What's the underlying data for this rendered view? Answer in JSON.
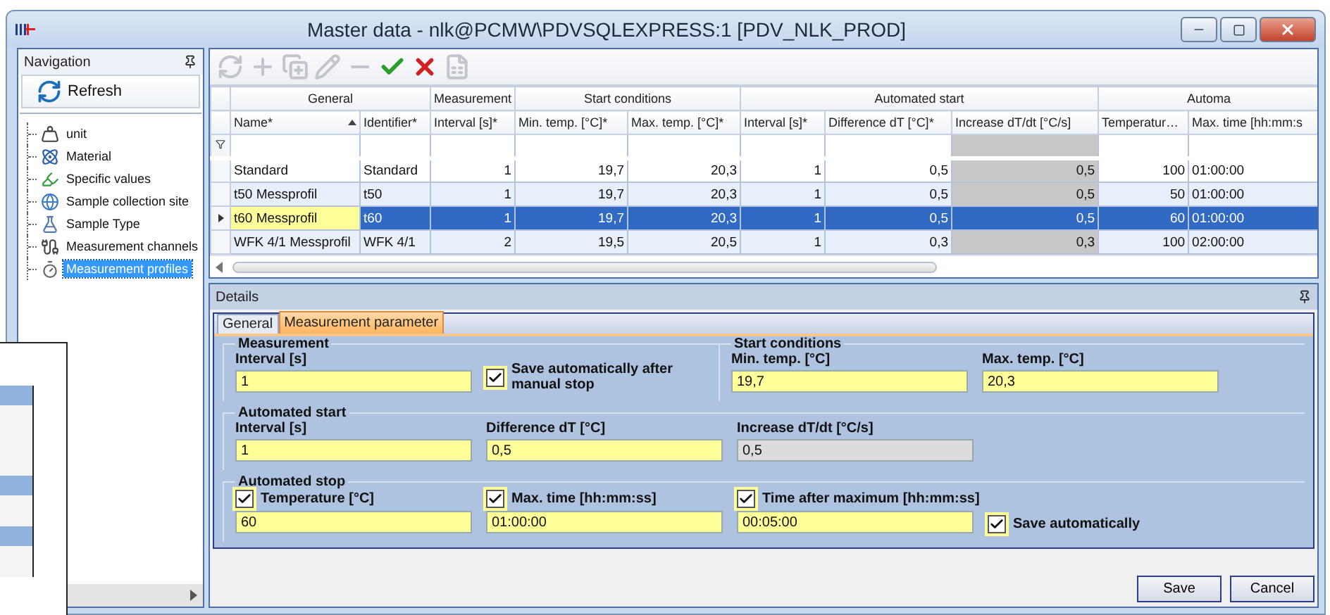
{
  "window": {
    "title": "Master data - nlk@PCMW\\PDVSQLEXPRESS:1 [PDV_NLK_PROD]"
  },
  "navigation": {
    "title": "Navigation",
    "refresh": "Refresh",
    "items": [
      {
        "kind": "unit",
        "label": "unit",
        "selected": false
      },
      {
        "kind": "material",
        "label": "Material",
        "selected": false
      },
      {
        "kind": "values",
        "label": "Specific values",
        "selected": false
      },
      {
        "kind": "site",
        "label": "Sample collection site",
        "selected": false
      },
      {
        "kind": "type",
        "label": "Sample Type",
        "selected": false
      },
      {
        "kind": "channels",
        "label": "Measurement channels",
        "selected": false
      },
      {
        "kind": "profiles",
        "label": "Measurement profiles",
        "selected": true
      }
    ]
  },
  "toolbar": [
    {
      "kind": "refresh",
      "disabled": true
    },
    {
      "kind": "add",
      "disabled": true
    },
    {
      "kind": "add-many",
      "disabled": true
    },
    {
      "kind": "edit",
      "disabled": true
    },
    {
      "kind": "remove",
      "disabled": true
    },
    {
      "kind": "accept",
      "disabled": false
    },
    {
      "kind": "cancel",
      "disabled": false
    },
    {
      "kind": "sheet",
      "disabled": true
    }
  ],
  "grid": {
    "groups": [
      {
        "label": "General",
        "columns": [
          {
            "label": "Name*",
            "sorted": true,
            "kind": "text",
            "readonly": false
          },
          {
            "label": "Identifier*",
            "sorted": false,
            "kind": "text",
            "readonly": false
          }
        ]
      },
      {
        "label": "Measurement",
        "columns": [
          {
            "label": "Interval [s]*",
            "sorted": false,
            "kind": "number",
            "readonly": false
          }
        ]
      },
      {
        "label": "Start conditions",
        "columns": [
          {
            "label": "Min. temp. [°C]*",
            "sorted": false,
            "kind": "number",
            "readonly": false
          },
          {
            "label": "Max. temp. [°C]*",
            "sorted": false,
            "kind": "number",
            "readonly": false
          }
        ]
      },
      {
        "label": "Automated start",
        "columns": [
          {
            "label": "Interval [s]*",
            "sorted": false,
            "kind": "number",
            "readonly": false
          },
          {
            "label": "Difference dT [°C]*",
            "sorted": false,
            "kind": "number",
            "readonly": false
          },
          {
            "label": "Increase dT/dt [°C/s]",
            "sorted": false,
            "kind": "number",
            "readonly": true
          }
        ]
      },
      {
        "label": "Automa",
        "columns": [
          {
            "label": "Temperatur…",
            "sorted": false,
            "kind": "number",
            "readonly": false
          },
          {
            "label": "Max. time [hh:mm:s",
            "sorted": false,
            "kind": "time",
            "readonly": false
          }
        ]
      }
    ],
    "rows": [
      {
        "selected": false,
        "name_cell_focused": false,
        "cells": [
          "Standard",
          "Standard",
          "1",
          "19,7",
          "20,3",
          "1",
          "0,5",
          "0,5",
          "100",
          "01:00:00"
        ]
      },
      {
        "selected": false,
        "name_cell_focused": false,
        "cells": [
          "t50 Messprofil",
          "t50",
          "1",
          "19,7",
          "20,3",
          "1",
          "0,5",
          "0,5",
          "50",
          "01:00:00"
        ]
      },
      {
        "selected": true,
        "name_cell_focused": true,
        "cells": [
          "t60 Messprofil",
          "t60",
          "1",
          "19,7",
          "20,3",
          "1",
          "0,5",
          "0,5",
          "60",
          "01:00:00"
        ]
      },
      {
        "selected": false,
        "name_cell_focused": false,
        "cells": [
          "WFK 4/1 Messprofil",
          "WFK 4/1",
          "2",
          "19,5",
          "20,5",
          "1",
          "0,3",
          "0,3",
          "100",
          "02:00:00"
        ]
      }
    ]
  },
  "details": {
    "title": "Details",
    "tabs": [
      {
        "label": "General",
        "selected": false
      },
      {
        "label": "Measurement parameter",
        "selected": true
      }
    ],
    "top_groups": [
      {
        "title": "Measurement",
        "fields": [
          {
            "kind": "field",
            "label": "Interval [s]",
            "value": "1",
            "readonly": false
          },
          {
            "kind": "checkbox",
            "label": "Save automatically after manual stop",
            "checked": true
          }
        ]
      },
      {
        "title": "Start conditions",
        "fields": [
          {
            "kind": "field",
            "label": "Min. temp. [°C]",
            "value": "19,7",
            "readonly": false
          },
          {
            "kind": "field",
            "label": "Max. temp. [°C]",
            "value": "20,3",
            "readonly": false
          }
        ]
      }
    ],
    "groups": [
      {
        "title": "Automated start",
        "fields": [
          {
            "kind": "field",
            "label": "Interval [s]",
            "value": "1",
            "readonly": false
          },
          {
            "kind": "field",
            "label": "Difference dT [°C]",
            "value": "0,5",
            "readonly": false
          },
          {
            "kind": "field",
            "label": "Increase dT/dt [°C/s]",
            "value": "0,5",
            "readonly": true
          }
        ]
      },
      {
        "title": "Automated stop",
        "fields": [
          {
            "kind": "checkfield",
            "label": "Temperature [°C]",
            "value": "60",
            "checked": true
          },
          {
            "kind": "checkfield",
            "label": "Max. time [hh:mm:ss]",
            "value": "01:00:00",
            "checked": true
          },
          {
            "kind": "checkfield",
            "label": "Time after maximum [hh:mm:ss]",
            "value": "00:05:00",
            "checked": true
          },
          {
            "kind": "checkbox",
            "label": "Save automatically",
            "checked": true
          }
        ]
      }
    ]
  },
  "buttons": [
    "Save",
    "Cancel"
  ]
}
